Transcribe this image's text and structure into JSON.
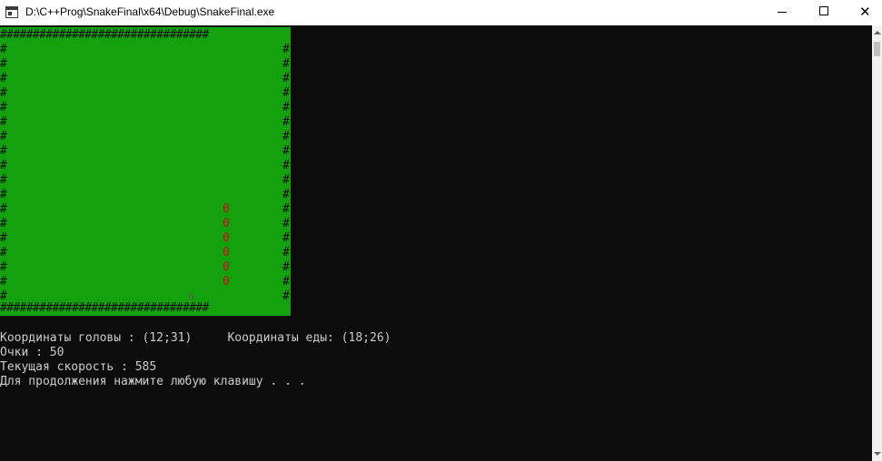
{
  "window": {
    "title": "D:\\C++Prog\\SnakeFinal\\x64\\Debug\\SnakeFinal.exe",
    "icons": [
      "console-app-icon",
      "minimize-icon",
      "maximize-icon",
      "close-icon"
    ],
    "close_glyph": "✕"
  },
  "game": {
    "wall_char": "#",
    "top_wall": "################################",
    "bottom_wall": "################################",
    "snake_char": "0",
    "food_char": "o",
    "snake_segments": 6,
    "field_color": "#13a10e",
    "snake_color": "#c50f1f"
  },
  "status": {
    "line1": "Координаты головы : (12;31)     Координаты еды: (18;26)",
    "line2": "Очки : 50",
    "line3": "Текущая скорость : 585",
    "line4": "Для продолжения нажмите любую клавишу . . ."
  }
}
